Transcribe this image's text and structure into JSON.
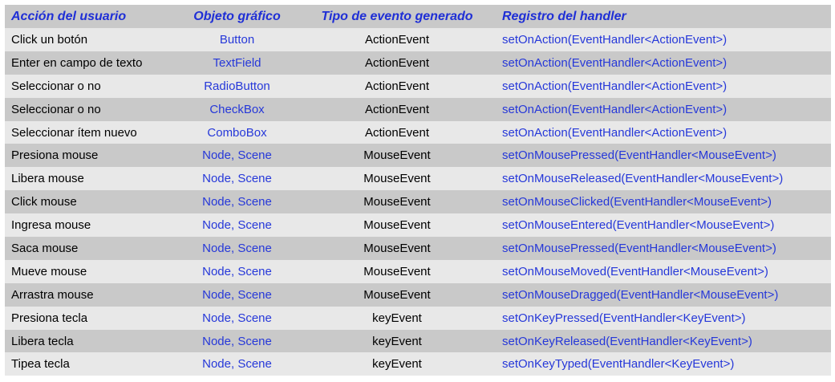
{
  "header": {
    "col1": "Acción del usuario",
    "col2": "Objeto gráfico",
    "col3": "Tipo de evento generado",
    "col4": "Registro del handler"
  },
  "rows": [
    {
      "action": "Click un botón",
      "object": "Button",
      "event": "ActionEvent",
      "handler": "setOnAction(EventHandler<ActionEvent>)"
    },
    {
      "action": "Enter en campo de texto",
      "object": "TextField",
      "event": "ActionEvent",
      "handler": "setOnAction(EventHandler<ActionEvent>)"
    },
    {
      "action": "Seleccionar o no",
      "object": "RadioButton",
      "event": "ActionEvent",
      "handler": "setOnAction(EventHandler<ActionEvent>)"
    },
    {
      "action": "Seleccionar o no",
      "object": "CheckBox",
      "event": "ActionEvent",
      "handler": "setOnAction(EventHandler<ActionEvent>)"
    },
    {
      "action": "Seleccionar ítem nuevo",
      "object": "ComboBox",
      "event": "ActionEvent",
      "handler": "setOnAction(EventHandler<ActionEvent>)"
    },
    {
      "action": "Presiona mouse",
      "object": "Node, Scene",
      "event": "MouseEvent",
      "handler": "setOnMousePressed(EventHandler<MouseEvent>)"
    },
    {
      "action": "Libera mouse",
      "object": "Node, Scene",
      "event": "MouseEvent",
      "handler": "setOnMouseReleased(EventHandler<MouseEvent>)"
    },
    {
      "action": "Click mouse",
      "object": "Node, Scene",
      "event": "MouseEvent",
      "handler": "setOnMouseClicked(EventHandler<MouseEvent>)"
    },
    {
      "action": "Ingresa mouse",
      "object": "Node, Scene",
      "event": "MouseEvent",
      "handler": "setOnMouseEntered(EventHandler<MouseEvent>)"
    },
    {
      "action": "Saca mouse",
      "object": "Node, Scene",
      "event": "MouseEvent",
      "handler": "setOnMousePressed(EventHandler<MouseEvent>)"
    },
    {
      "action": "Mueve mouse",
      "object": "Node, Scene",
      "event": "MouseEvent",
      "handler": "setOnMouseMoved(EventHandler<MouseEvent>)"
    },
    {
      "action": "Arrastra mouse",
      "object": "Node, Scene",
      "event": "MouseEvent",
      "handler": "setOnMouseDragged(EventHandler<MouseEvent>)"
    },
    {
      "action": "Presiona tecla",
      "object": "Node, Scene",
      "event": "keyEvent",
      "handler": "setOnKeyPressed(EventHandler<KeyEvent>)"
    },
    {
      "action": "Libera tecla",
      "object": "Node, Scene",
      "event": "keyEvent",
      "handler": "setOnKeyReleased(EventHandler<KeyEvent>)"
    },
    {
      "action": "Tipea tecla",
      "object": "Node, Scene",
      "event": "keyEvent",
      "handler": "setOnKeyTyped(EventHandler<KeyEvent>)"
    }
  ],
  "colors": {
    "header_text": "#1f2fd6",
    "link_text": "#2638d9",
    "row_dark": "#c9c9c9",
    "row_light": "#e8e8e8"
  }
}
